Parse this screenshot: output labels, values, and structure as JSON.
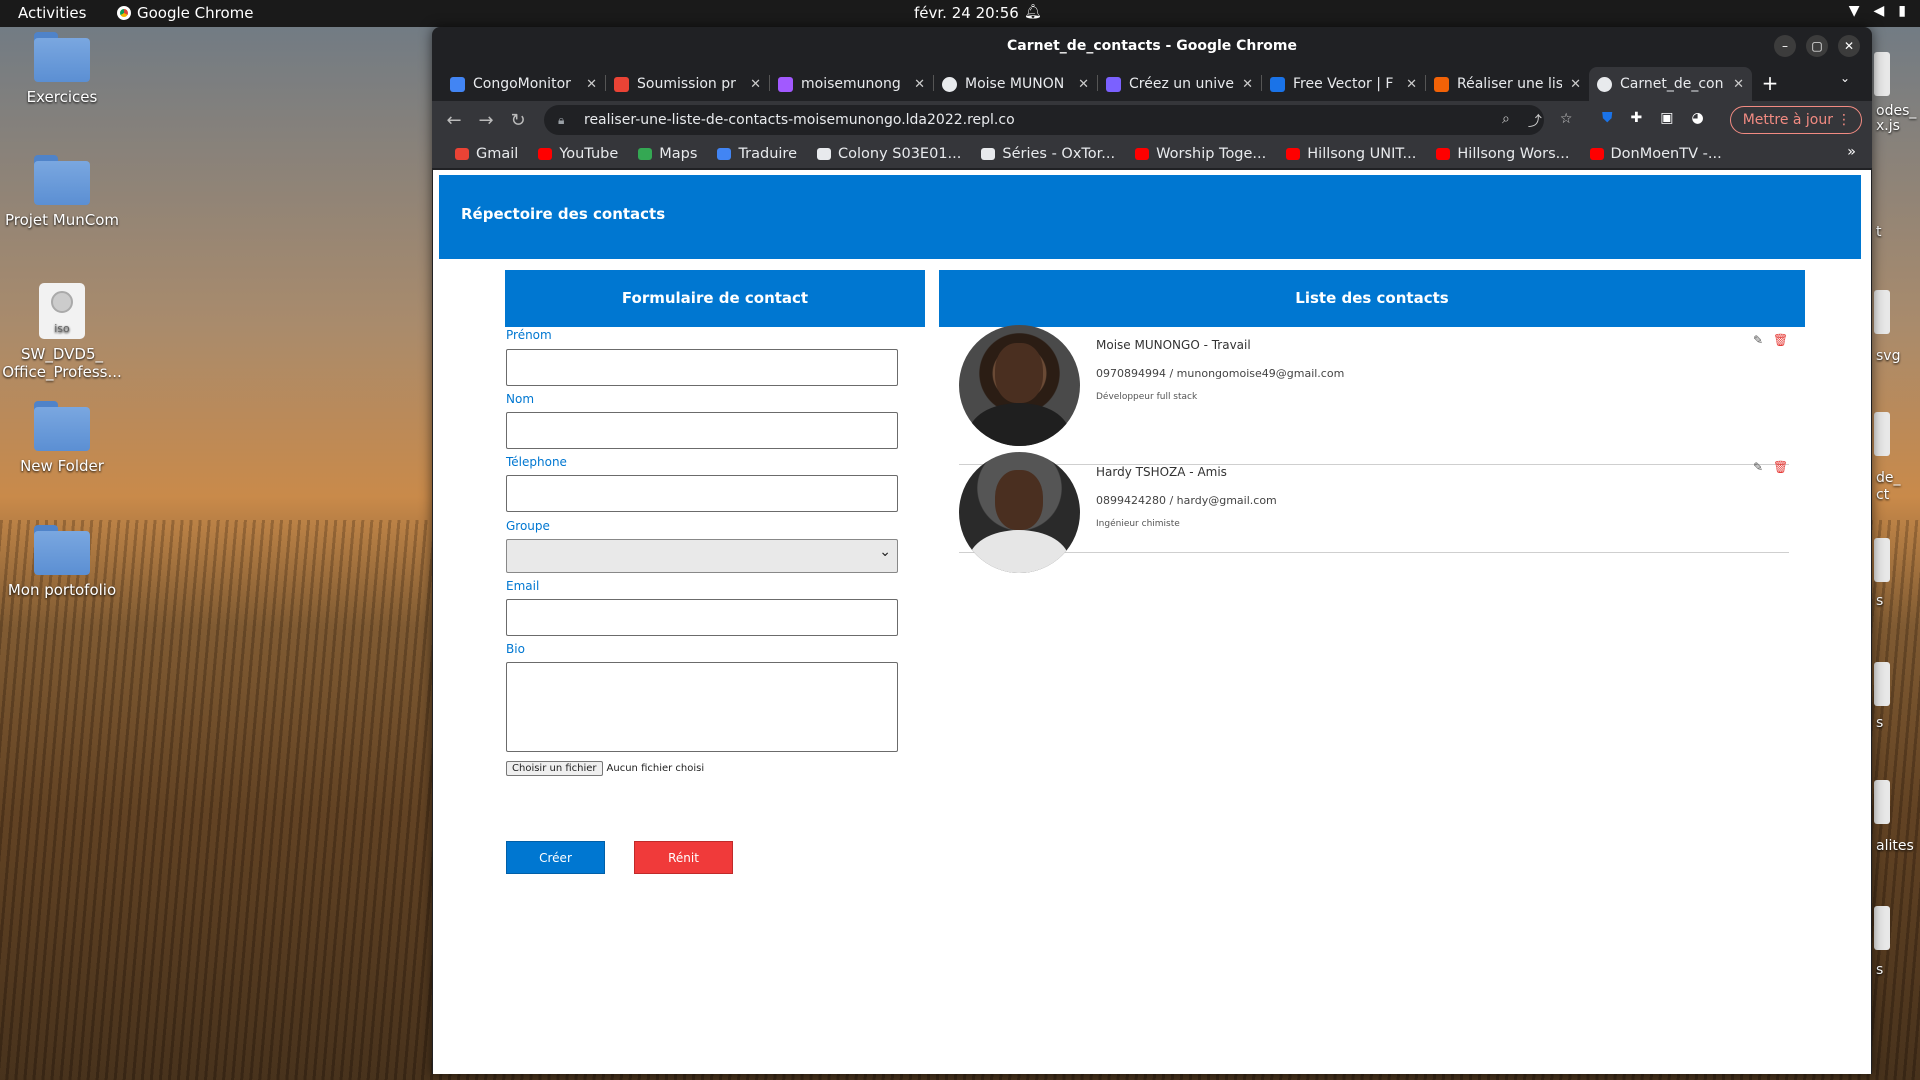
{
  "topbar": {
    "activities": "Activities",
    "app_name": "Google Chrome",
    "clock": "févr. 24  20:56"
  },
  "desktop": {
    "icons": [
      {
        "label": "Exercices"
      },
      {
        "label": "Projet MunCom"
      },
      {
        "label": "SW_DVD5_\nOffice_Profess...",
        "iso_tag": "iso"
      },
      {
        "label": "New Folder"
      },
      {
        "label": "Mon portofolio"
      }
    ],
    "right_edge": [
      "odes_",
      "x.js",
      "t",
      "svg",
      "de_",
      "ct",
      "s",
      "s",
      "alites",
      "s"
    ]
  },
  "window": {
    "title": "Carnet_de_contacts - Google Chrome",
    "tabs": [
      {
        "title": "CongoMonitor",
        "color": "#4285f4"
      },
      {
        "title": "Soumission pr",
        "color": "#ea4335"
      },
      {
        "title": "moisemunong",
        "color": "#a259ff"
      },
      {
        "title": "Moise MUNON",
        "color": "#e8eaed"
      },
      {
        "title": "Créez un unive",
        "color": "#7b61ff"
      },
      {
        "title": "Free Vector | F",
        "color": "#1a73e8"
      },
      {
        "title": "Réaliser une lis",
        "color": "#f26207"
      },
      {
        "title": "Carnet_de_con",
        "color": "#e8eaed",
        "active": true
      }
    ],
    "url": "realiser-une-liste-de-contacts-moisemunongo.lda2022.repl.co",
    "update_button": "Mettre à jour",
    "bookmarks": [
      {
        "label": "Gmail",
        "color": "#ea4335"
      },
      {
        "label": "YouTube",
        "color": "#ff0000"
      },
      {
        "label": "Maps",
        "color": "#34a853"
      },
      {
        "label": "Traduire",
        "color": "#4285f4"
      },
      {
        "label": "Colony S03E01...",
        "color": "#e8eaed"
      },
      {
        "label": "Séries - OxTor...",
        "color": "#e8eaed"
      },
      {
        "label": "Worship Toge...",
        "color": "#ff0000"
      },
      {
        "label": "Hillsong UNIT...",
        "color": "#ff0000"
      },
      {
        "label": "Hillsong Wors...",
        "color": "#ff0000"
      },
      {
        "label": "DonMoenTV -...",
        "color": "#ff0000"
      }
    ]
  },
  "page": {
    "header": "Répectoire des contacts",
    "form_title": "Formulaire de contact",
    "list_title": "Liste des contacts",
    "labels": {
      "prenom": "Prénom",
      "nom": "Nom",
      "telephone": "Télephone",
      "groupe": "Groupe",
      "email": "Email",
      "bio": "Bio"
    },
    "file_button": "Choisir un fichier",
    "file_status": "Aucun fichier choisi",
    "create_button": "Créer",
    "reset_button": "Rénit",
    "accent": "#0077d1",
    "danger": "#f03a3a",
    "contacts": [
      {
        "name_group": "Moise MUNONGO - Travail",
        "phone_email": "0970894994 / munongomoise49@gmail.com",
        "bio": "Développeur full stack"
      },
      {
        "name_group": "Hardy TSHOZA - Amis",
        "phone_email": "0899424280 / hardy@gmail.com",
        "bio": "Ingénieur chimiste"
      }
    ]
  }
}
